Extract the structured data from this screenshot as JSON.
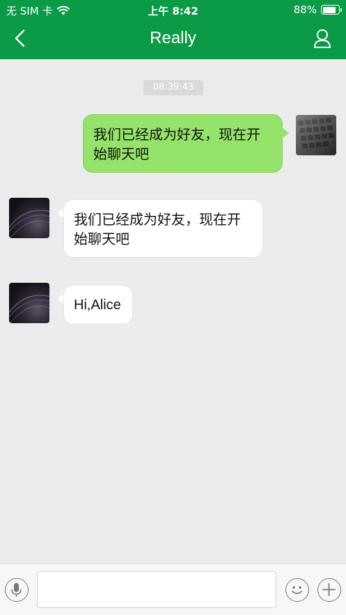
{
  "status_bar": {
    "carrier": "无 SIM 卡",
    "time": "上午 8:42",
    "battery": "88%",
    "battery_level": 0.88
  },
  "nav": {
    "title": "Really",
    "back_icon": "chevron-left-icon",
    "profile_icon": "user-icon"
  },
  "chat": {
    "timestamp": "08:39:43",
    "messages": [
      {
        "from": "me",
        "text_line1": "我们已经成为好友，现在开",
        "text_line2": "始聊天吧"
      },
      {
        "from": "friend",
        "text_line1": "我们已经成为好友，现在开",
        "text_line2": "始聊天吧"
      },
      {
        "from": "friend",
        "text": "Hi,Alice"
      }
    ]
  },
  "input_bar": {
    "value": "",
    "voice_icon": "microphone-icon",
    "emoji_icon": "smiley-icon",
    "add_icon": "plus-icon"
  },
  "colors": {
    "nav_bg": "#0b9a46",
    "my_bubble": "#95e36b",
    "their_bubble": "#ffffff",
    "chat_bg": "#ececec"
  }
}
